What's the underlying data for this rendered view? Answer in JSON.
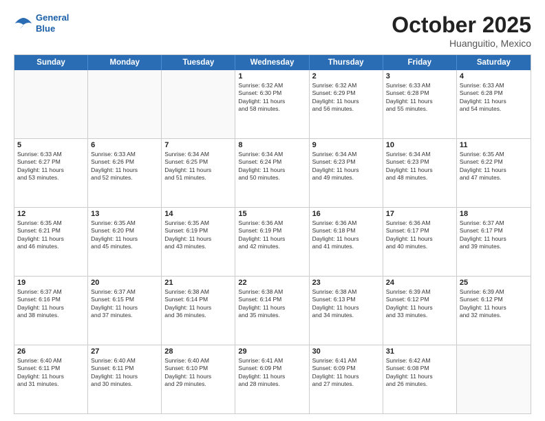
{
  "header": {
    "logo_line1": "General",
    "logo_line2": "Blue",
    "month": "October 2025",
    "location": "Huanguitio, Mexico"
  },
  "weekdays": [
    "Sunday",
    "Monday",
    "Tuesday",
    "Wednesday",
    "Thursday",
    "Friday",
    "Saturday"
  ],
  "rows": [
    [
      {
        "day": "",
        "text": ""
      },
      {
        "day": "",
        "text": ""
      },
      {
        "day": "",
        "text": ""
      },
      {
        "day": "1",
        "text": "Sunrise: 6:32 AM\nSunset: 6:30 PM\nDaylight: 11 hours\nand 58 minutes."
      },
      {
        "day": "2",
        "text": "Sunrise: 6:32 AM\nSunset: 6:29 PM\nDaylight: 11 hours\nand 56 minutes."
      },
      {
        "day": "3",
        "text": "Sunrise: 6:33 AM\nSunset: 6:28 PM\nDaylight: 11 hours\nand 55 minutes."
      },
      {
        "day": "4",
        "text": "Sunrise: 6:33 AM\nSunset: 6:28 PM\nDaylight: 11 hours\nand 54 minutes."
      }
    ],
    [
      {
        "day": "5",
        "text": "Sunrise: 6:33 AM\nSunset: 6:27 PM\nDaylight: 11 hours\nand 53 minutes."
      },
      {
        "day": "6",
        "text": "Sunrise: 6:33 AM\nSunset: 6:26 PM\nDaylight: 11 hours\nand 52 minutes."
      },
      {
        "day": "7",
        "text": "Sunrise: 6:34 AM\nSunset: 6:25 PM\nDaylight: 11 hours\nand 51 minutes."
      },
      {
        "day": "8",
        "text": "Sunrise: 6:34 AM\nSunset: 6:24 PM\nDaylight: 11 hours\nand 50 minutes."
      },
      {
        "day": "9",
        "text": "Sunrise: 6:34 AM\nSunset: 6:23 PM\nDaylight: 11 hours\nand 49 minutes."
      },
      {
        "day": "10",
        "text": "Sunrise: 6:34 AM\nSunset: 6:23 PM\nDaylight: 11 hours\nand 48 minutes."
      },
      {
        "day": "11",
        "text": "Sunrise: 6:35 AM\nSunset: 6:22 PM\nDaylight: 11 hours\nand 47 minutes."
      }
    ],
    [
      {
        "day": "12",
        "text": "Sunrise: 6:35 AM\nSunset: 6:21 PM\nDaylight: 11 hours\nand 46 minutes."
      },
      {
        "day": "13",
        "text": "Sunrise: 6:35 AM\nSunset: 6:20 PM\nDaylight: 11 hours\nand 45 minutes."
      },
      {
        "day": "14",
        "text": "Sunrise: 6:35 AM\nSunset: 6:19 PM\nDaylight: 11 hours\nand 43 minutes."
      },
      {
        "day": "15",
        "text": "Sunrise: 6:36 AM\nSunset: 6:19 PM\nDaylight: 11 hours\nand 42 minutes."
      },
      {
        "day": "16",
        "text": "Sunrise: 6:36 AM\nSunset: 6:18 PM\nDaylight: 11 hours\nand 41 minutes."
      },
      {
        "day": "17",
        "text": "Sunrise: 6:36 AM\nSunset: 6:17 PM\nDaylight: 11 hours\nand 40 minutes."
      },
      {
        "day": "18",
        "text": "Sunrise: 6:37 AM\nSunset: 6:17 PM\nDaylight: 11 hours\nand 39 minutes."
      }
    ],
    [
      {
        "day": "19",
        "text": "Sunrise: 6:37 AM\nSunset: 6:16 PM\nDaylight: 11 hours\nand 38 minutes."
      },
      {
        "day": "20",
        "text": "Sunrise: 6:37 AM\nSunset: 6:15 PM\nDaylight: 11 hours\nand 37 minutes."
      },
      {
        "day": "21",
        "text": "Sunrise: 6:38 AM\nSunset: 6:14 PM\nDaylight: 11 hours\nand 36 minutes."
      },
      {
        "day": "22",
        "text": "Sunrise: 6:38 AM\nSunset: 6:14 PM\nDaylight: 11 hours\nand 35 minutes."
      },
      {
        "day": "23",
        "text": "Sunrise: 6:38 AM\nSunset: 6:13 PM\nDaylight: 11 hours\nand 34 minutes."
      },
      {
        "day": "24",
        "text": "Sunrise: 6:39 AM\nSunset: 6:12 PM\nDaylight: 11 hours\nand 33 minutes."
      },
      {
        "day": "25",
        "text": "Sunrise: 6:39 AM\nSunset: 6:12 PM\nDaylight: 11 hours\nand 32 minutes."
      }
    ],
    [
      {
        "day": "26",
        "text": "Sunrise: 6:40 AM\nSunset: 6:11 PM\nDaylight: 11 hours\nand 31 minutes."
      },
      {
        "day": "27",
        "text": "Sunrise: 6:40 AM\nSunset: 6:11 PM\nDaylight: 11 hours\nand 30 minutes."
      },
      {
        "day": "28",
        "text": "Sunrise: 6:40 AM\nSunset: 6:10 PM\nDaylight: 11 hours\nand 29 minutes."
      },
      {
        "day": "29",
        "text": "Sunrise: 6:41 AM\nSunset: 6:09 PM\nDaylight: 11 hours\nand 28 minutes."
      },
      {
        "day": "30",
        "text": "Sunrise: 6:41 AM\nSunset: 6:09 PM\nDaylight: 11 hours\nand 27 minutes."
      },
      {
        "day": "31",
        "text": "Sunrise: 6:42 AM\nSunset: 6:08 PM\nDaylight: 11 hours\nand 26 minutes."
      },
      {
        "day": "",
        "text": ""
      }
    ]
  ]
}
